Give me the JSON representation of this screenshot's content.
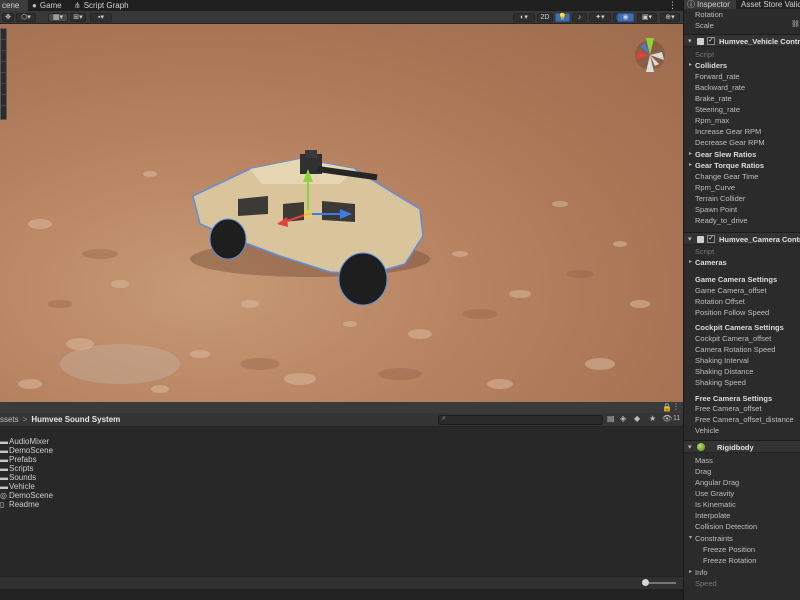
{
  "tabs": [
    {
      "label": "cene",
      "icon": "",
      "active": true
    },
    {
      "label": "Game",
      "icon": "game-controller-icon",
      "active": false
    },
    {
      "label": "Script Graph",
      "icon": "graph-icon",
      "active": false
    }
  ],
  "scene_toolbar": {
    "mode_2d": "2D"
  },
  "project": {
    "breadcrumb_root": "ssets",
    "breadcrumb_current": "Humvee Sound System",
    "hidden_count": "11",
    "assets": [
      {
        "name": "AudioMixer",
        "type": "folder"
      },
      {
        "name": "DemoScene",
        "type": "folder"
      },
      {
        "name": "Prefabs",
        "type": "folder"
      },
      {
        "name": "Scripts",
        "type": "folder"
      },
      {
        "name": "Sounds",
        "type": "folder"
      },
      {
        "name": "Vehicle",
        "type": "folder"
      },
      {
        "name": "DemoScene",
        "type": "scene"
      },
      {
        "name": "Readme",
        "type": "file"
      }
    ]
  },
  "inspector": {
    "tabs": [
      {
        "label": "Inspector",
        "active": true
      },
      {
        "label": "Asset Store Validat",
        "active": false
      }
    ],
    "transform_rows": [
      "Rotation",
      "Scale"
    ],
    "vehicle_controller": {
      "title": "Humvee_Vehicle Controll",
      "script_label": "Script",
      "rows": [
        {
          "label": "Colliders",
          "bold": true,
          "fold": true
        },
        {
          "label": "Forward_rate"
        },
        {
          "label": "Backward_rate"
        },
        {
          "label": "Brake_rate"
        },
        {
          "label": "Steering_rate"
        },
        {
          "label": "Rpm_max"
        },
        {
          "label": "Increase Gear RPM"
        },
        {
          "label": "Decrease Gear RPM"
        },
        {
          "label": "Gear Slew Ratios",
          "bold": true,
          "fold": true
        },
        {
          "label": "Gear Torque Ratios",
          "bold": true,
          "fold": true
        },
        {
          "label": "Change Gear Time"
        },
        {
          "label": "Rpm_Curve"
        },
        {
          "label": "Terrain Collider"
        },
        {
          "label": "Spawn Point"
        },
        {
          "label": "Ready_to_drive"
        }
      ]
    },
    "camera_controller": {
      "title": "Humvee_Camera Controll",
      "script_label": "Script",
      "cameras_label": "Cameras",
      "game_section": "Game Camera Settings",
      "game_rows": [
        "Game Camera_offset",
        "Rotation Offset",
        "Position Follow Speed"
      ],
      "cockpit_section": "Cockpit Camera Settings",
      "cockpit_rows": [
        "Cockpit Camera_offset",
        "Camera Rotation Speed",
        "Shaking Interval",
        "Shaking Distance",
        "Shaking Speed"
      ],
      "free_section": "Free Camera Settings",
      "free_rows": [
        "Free Camera_offset",
        "Free Camera_offset_distance",
        "Vehicle"
      ]
    },
    "rigidbody": {
      "title": "Rigidbody",
      "rows": [
        "Mass",
        "Drag",
        "Angular Drag",
        "Use Gravity",
        "Is Kinematic",
        "Interpolate",
        "Collision Detection"
      ],
      "constraints_label": "Constraints",
      "constraint_rows": [
        "Freeze Position",
        "Freeze Rotation"
      ],
      "info_label": "Info",
      "speed_label": "Speed"
    }
  },
  "colors": {
    "terrain_base": "#b98462",
    "humvee_body": "#d9c49c",
    "selection_outline": "#5b8fe0",
    "gizmo_x": "#e0413a",
    "gizmo_y": "#8bd43c",
    "gizmo_z": "#3d7be6",
    "accent_blue": "#3c6db5"
  }
}
